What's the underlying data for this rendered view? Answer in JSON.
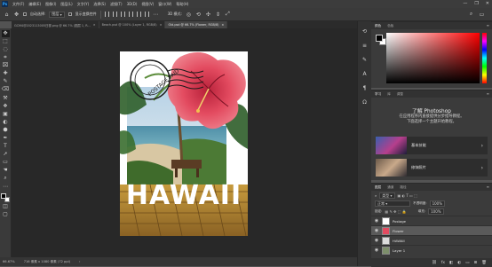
{
  "menubar": {
    "logo": "Ps",
    "items": [
      "文件(F)",
      "编辑(E)",
      "图像(I)",
      "图层(L)",
      "文字(Y)",
      "选择(S)",
      "滤镜(T)",
      "3D(D)",
      "视图(V)",
      "窗口(W)",
      "帮助(H)"
    ],
    "window_buttons": [
      "—",
      "❐",
      "✕"
    ]
  },
  "options_bar": {
    "auto_select_label": "自动选择:",
    "auto_select_value": "图层",
    "show_transform_label": "显示变换控件",
    "mode_label": "3D 模式:"
  },
  "tabs": [
    {
      "label": "GCM4@2023113005日视.png @ 66.7% (图层 1, R...",
      "active": false
    },
    {
      "label": "Beach.psd @ 100% (Layer 1, RGB/8)",
      "active": false
    },
    {
      "label": "Old.psd @ 66.7% (Flower, RGB/8)",
      "active": true
    }
  ],
  "tools": [
    "✥",
    "⬚",
    "◌",
    "⌗",
    "⌧",
    "✚",
    "✎",
    "⌫",
    "⚒",
    "❖",
    "▣",
    "◐",
    "⬢",
    "✒",
    "T",
    "➚",
    "▭",
    "☚",
    "⌕",
    "⋯"
  ],
  "artwork": {
    "stamp_text": "POSTAGE PAID",
    "headline": "HAWAII"
  },
  "status": {
    "zoom": "66.67%",
    "doc_info": "716 像素 x 1080 像素 (72 ppi)"
  },
  "color_panel": {
    "tabs": [
      "颜色",
      "色板"
    ]
  },
  "learn_panel": {
    "tabs": [
      "学习",
      "库",
      "调整"
    ],
    "title": "了解 Photoshop",
    "description_line1": "在应用程序内直接提供分步指导教程。",
    "description_line2": "下面选择一个主题开始教程。",
    "cards": [
      {
        "label": "基本技能"
      },
      {
        "label": "修饰照片"
      }
    ]
  },
  "layers_panel": {
    "tabs": [
      "图层",
      "通道",
      "路径"
    ],
    "kind_label": "类型",
    "blend_mode": "正常",
    "opacity_label": "不透明度:",
    "opacity_value": "100%",
    "lock_label": "锁定:",
    "fill_label": "填充:",
    "fill_value": "100%",
    "layers": [
      {
        "name": "Postage",
        "selected": false
      },
      {
        "name": "Flower",
        "selected": true
      },
      {
        "name": "HAWAII",
        "selected": false
      },
      {
        "name": "Layer 1",
        "selected": false
      }
    ],
    "footer_icons": [
      "⛓",
      "fx",
      "◧",
      "◐",
      "▭",
      "⊞",
      "🗑"
    ]
  },
  "colors": {
    "ui_dark": "#3a3a3a",
    "canvas_bg": "#282828",
    "accent": "#31a8ff",
    "hibiscus": "#e34b60"
  }
}
